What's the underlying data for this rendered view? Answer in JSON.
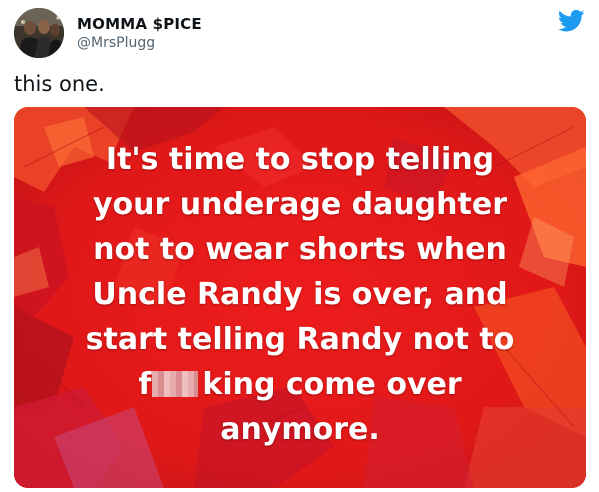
{
  "tweet": {
    "display_name": "MOMMA $PICE",
    "handle": "@MrsPlugg",
    "text": "this one."
  },
  "image": {
    "lines": [
      "It's time to stop telling",
      "your underage daughter",
      "not to wear shorts when",
      "Uncle Randy is over, and",
      "start telling Randy not to"
    ],
    "line6_start": "f",
    "line6_end": "king come over",
    "line7": "anymore."
  },
  "icons": {
    "brand": "twitter-bird-icon",
    "avatar": "profile-photo"
  },
  "colors": {
    "twitter_blue": "#1d9bf0",
    "background_red": "#e11a1a",
    "text_white": "#ffffff",
    "handle_gray": "#536471"
  }
}
